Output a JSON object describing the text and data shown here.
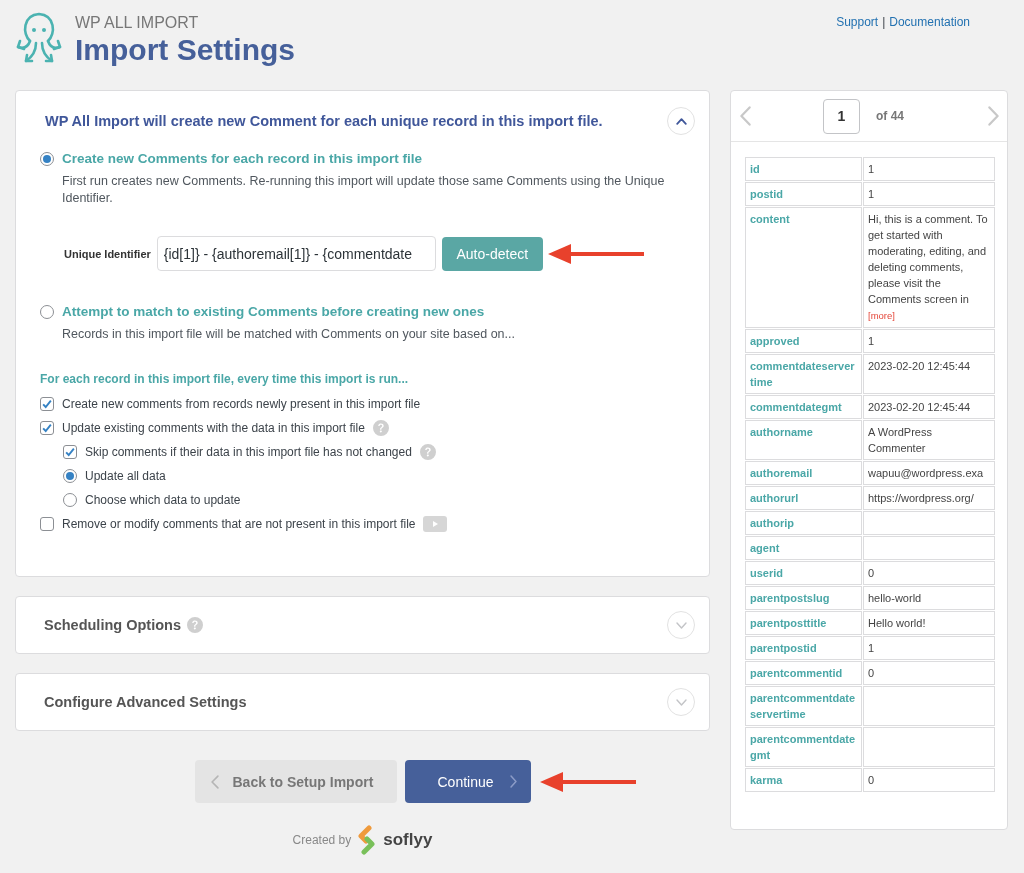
{
  "header": {
    "brand": "WP ALL IMPORT",
    "title": "Import Settings",
    "links": [
      {
        "label": "Support"
      },
      {
        "label": "Documentation"
      }
    ],
    "separator": "|"
  },
  "panels": [
    {
      "title": "WP All Import will create new Comment for each unique record in this import file.",
      "expanded": true,
      "options": [
        {
          "label": "Create new Comments for each record in this import file",
          "selected": true,
          "description": "First run creates new Comments. Re-running this import will update those same Comments using the Unique Identifier.",
          "unique_identifier": {
            "label": "Unique Identifier",
            "value": "{id[1]} - {authoremail[1]} - {commentdate",
            "button": "Auto-detect"
          }
        },
        {
          "label": "Attempt to match to existing Comments before creating new ones",
          "selected": false,
          "description": "Records in this import file will be matched with Comments on your site based on..."
        }
      ],
      "section_heading": "For each record in this import file, every time this import is run...",
      "settings": [
        {
          "kind": "checkbox",
          "label": "Create new comments from records newly present in this import file",
          "checked": true
        },
        {
          "kind": "checkbox",
          "label": "Update existing comments with the data in this import file",
          "checked": true,
          "help": true,
          "children": [
            {
              "kind": "checkbox",
              "label": "Skip comments if their data in this import file has not changed",
              "checked": true,
              "help": true
            },
            {
              "kind": "radio",
              "label": "Update all data",
              "selected": true
            },
            {
              "kind": "radio",
              "label": "Choose which data to update",
              "selected": false
            }
          ]
        },
        {
          "kind": "checkbox",
          "label": "Remove or modify comments that are not present in this import file",
          "checked": false,
          "video": true
        }
      ]
    },
    {
      "title": "Scheduling Options",
      "expanded": false,
      "help": true
    },
    {
      "title": "Configure Advanced Settings",
      "expanded": false
    }
  ],
  "footer": {
    "buttons": [
      {
        "kind": "back",
        "label": "Back to Setup Import"
      },
      {
        "kind": "next",
        "label": "Continue"
      }
    ],
    "credit": {
      "prefix": "Created by",
      "brand": "soflyy"
    }
  },
  "preview": {
    "page": "1",
    "total": "of 44",
    "rows": [
      {
        "key": "id",
        "value": "1"
      },
      {
        "key": "postid",
        "value": "1"
      },
      {
        "key": "content",
        "value": "Hi, this is a comment. To get started with moderating, editing, and deleting comments, please visit the Comments screen in",
        "more": "[more]"
      },
      {
        "key": "approved",
        "value": "1"
      },
      {
        "key": "commentdateservertime",
        "value": "2023-02-20 12:45:44"
      },
      {
        "key": "commentdategmt",
        "value": "2023-02-20 12:45:44"
      },
      {
        "key": "authorname",
        "value": "A WordPress Commenter"
      },
      {
        "key": "authoremail",
        "value": "wapuu@wordpress.exa"
      },
      {
        "key": "authorurl",
        "value": "https://wordpress.org/"
      },
      {
        "key": "authorip"
      },
      {
        "key": "agent"
      },
      {
        "key": "userid",
        "value": "0"
      },
      {
        "key": "parentpostslug",
        "value": "hello-world"
      },
      {
        "key": "parentposttitle",
        "value": "Hello world!"
      },
      {
        "key": "parentpostid",
        "value": "1"
      },
      {
        "key": "parentcommentid",
        "value": "0"
      },
      {
        "key": "parentcommentdateservertime"
      },
      {
        "key": "parentcommentdategmt"
      },
      {
        "key": "karma",
        "value": "0"
      }
    ]
  }
}
